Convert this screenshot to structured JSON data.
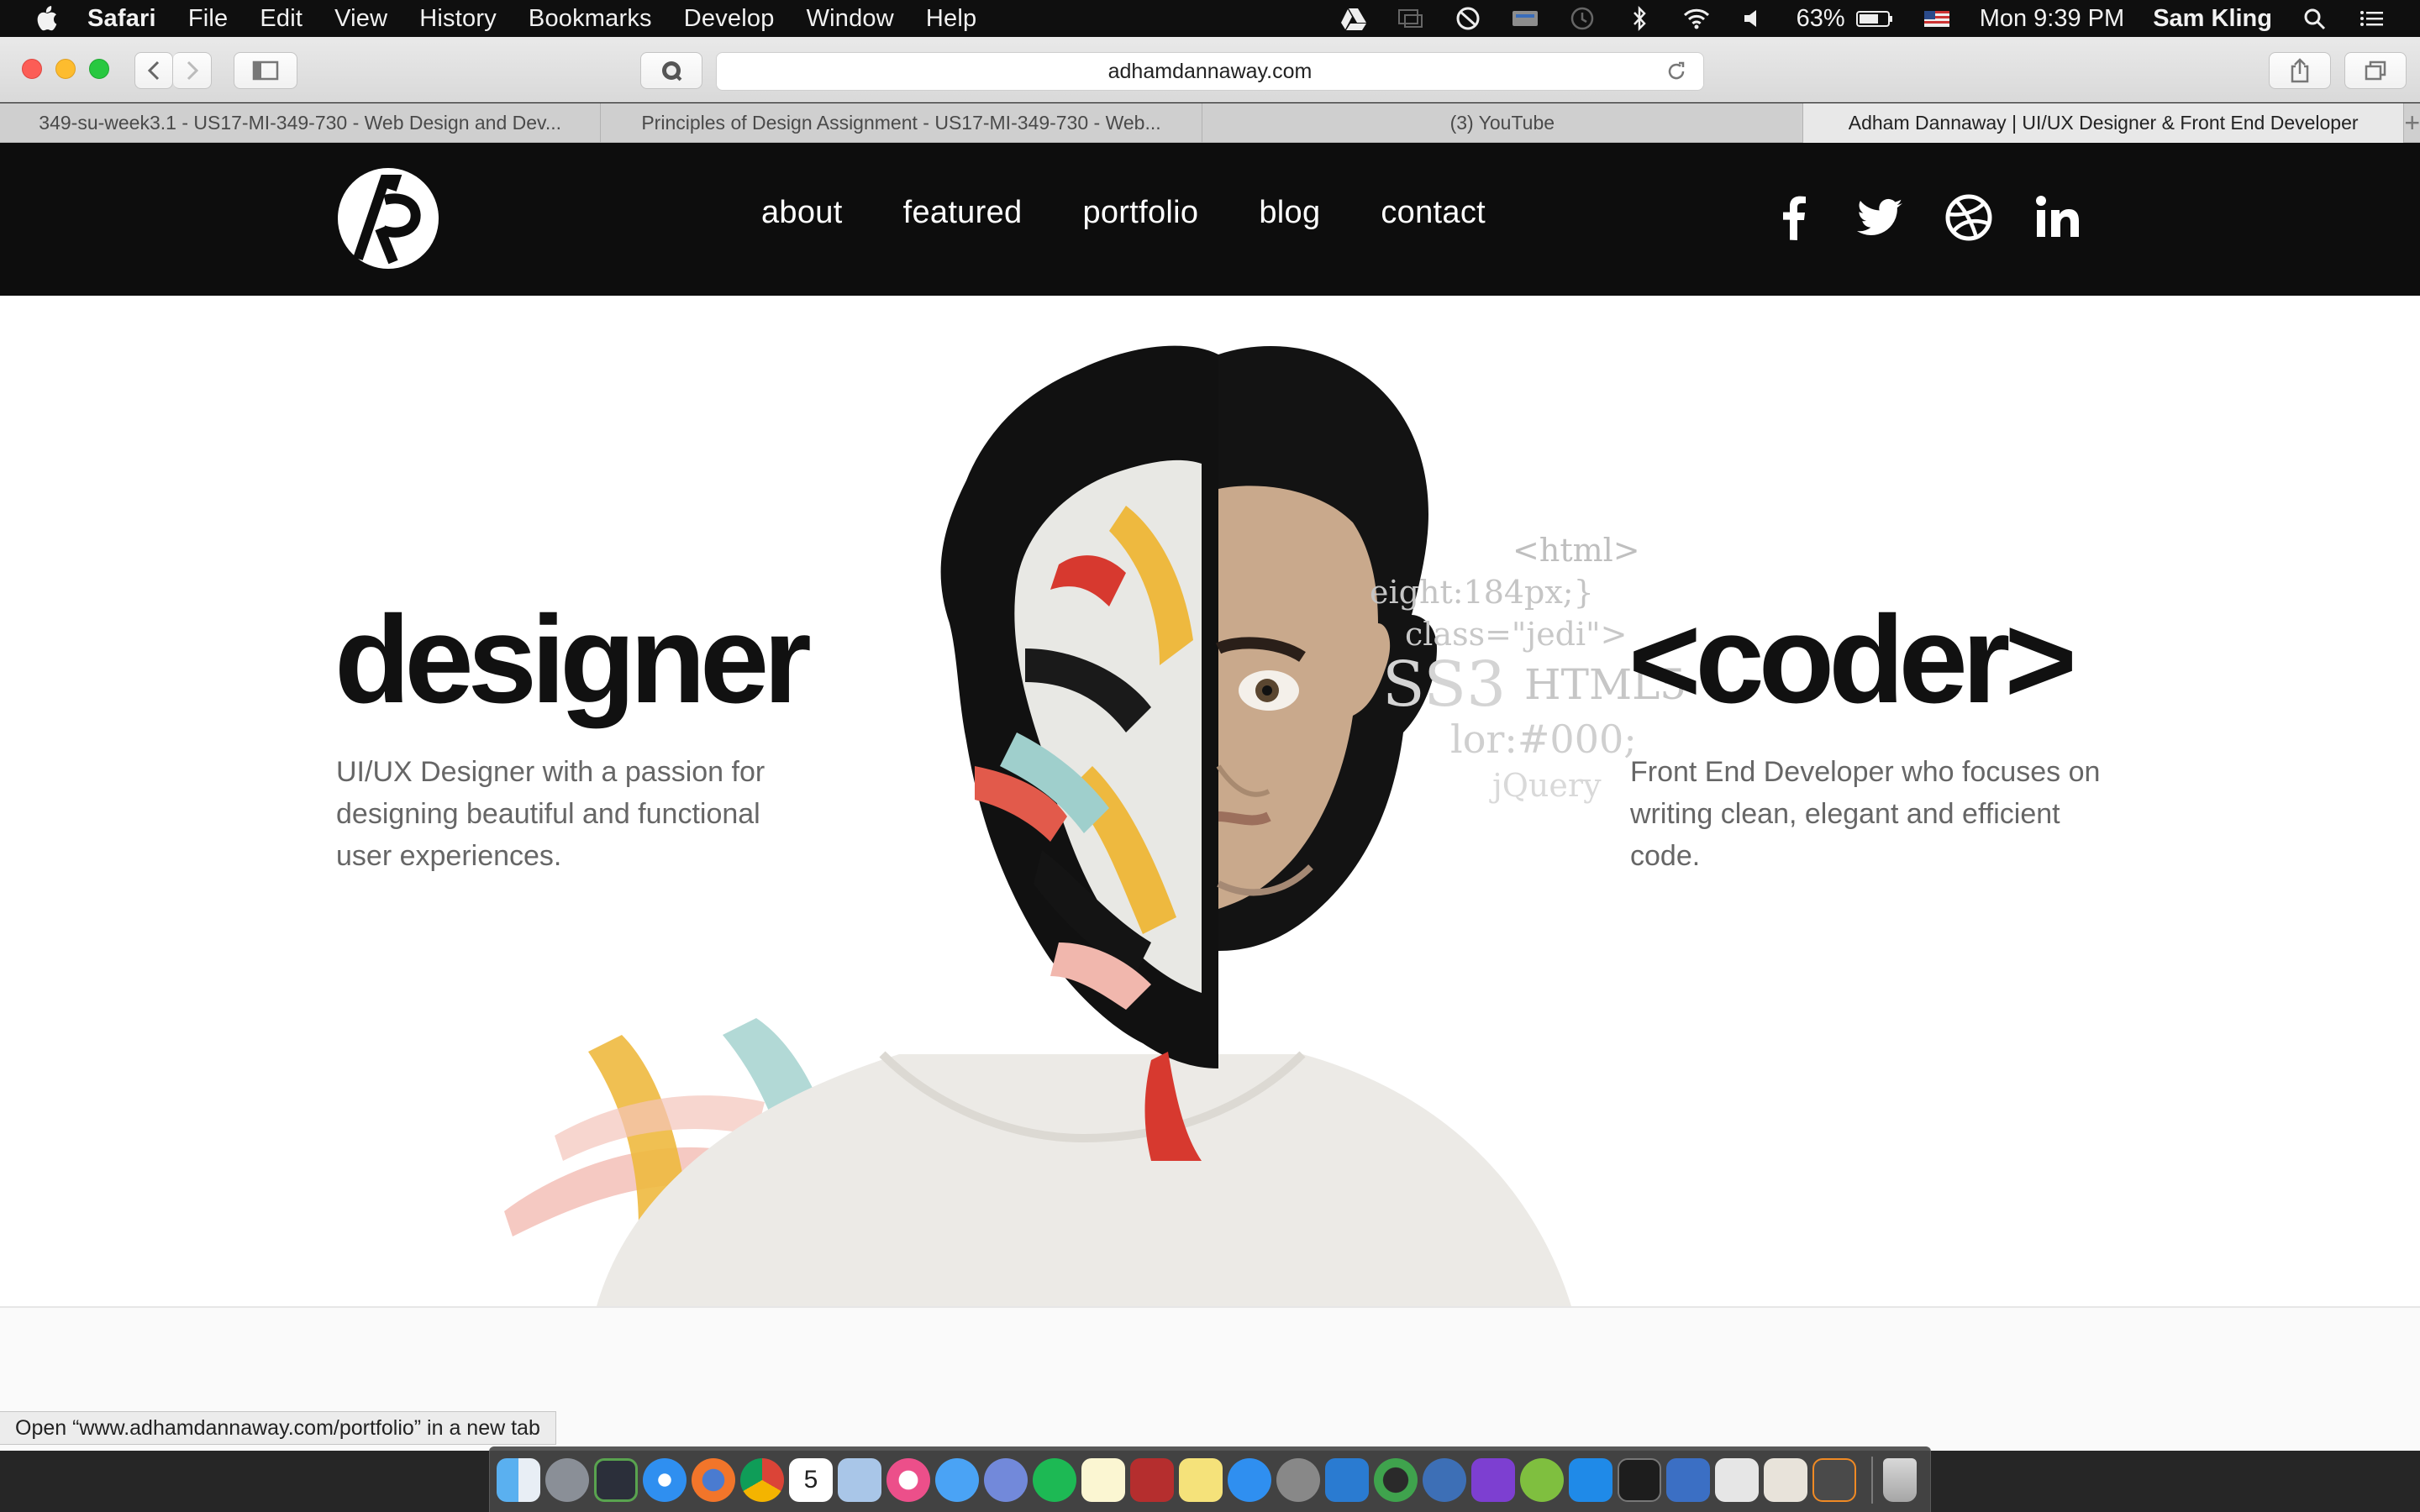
{
  "menubar": {
    "app": "Safari",
    "items": [
      "File",
      "Edit",
      "View",
      "History",
      "Bookmarks",
      "Develop",
      "Window",
      "Help"
    ],
    "battery": "63%",
    "clock": "Mon 9:39 PM",
    "user": "Sam Kling",
    "status_icons": [
      "google-drive-icon",
      "screen-mirror-icon",
      "do-not-disturb-icon",
      "keyboard-icon",
      "time-machine-icon",
      "bluetooth-icon",
      "wifi-icon",
      "volume-icon",
      "battery-icon",
      "us-flag-icon",
      "spotlight-search-icon",
      "notification-center-icon"
    ]
  },
  "toolbar": {
    "url": "adhamdannaway.com"
  },
  "tabs": [
    {
      "label": "349-su-week3.1 - US17-MI-349-730 - Web Design and Dev..."
    },
    {
      "label": "Principles of Design Assignment - US17-MI-349-730 - Web..."
    },
    {
      "label": "(3) YouTube"
    },
    {
      "label": "Adham Dannaway | UI/UX Designer & Front End Developer"
    }
  ],
  "site": {
    "nav": [
      "about",
      "featured",
      "portfolio",
      "blog",
      "contact"
    ],
    "social": [
      "facebook-icon",
      "twitter-icon",
      "dribbble-icon",
      "linkedin-icon"
    ],
    "designer": {
      "heading": "designer",
      "desc": "UI/UX Designer with a passion for designing beautiful and functional user experiences."
    },
    "coder": {
      "heading": "<coder>",
      "desc": "Front End Developer who focuses on writing clean, elegant and efficient code."
    },
    "code_snippets": [
      "<html>",
      "eight:184px;}",
      "class=\"jedi\">",
      "SS3",
      "HTML5",
      "lor:#000;",
      "jQuery"
    ]
  },
  "status_bar": {
    "text": "Open “www.adhamdannaway.com/portfolio” in a new tab"
  },
  "dock": {
    "apps": [
      "finder-icon",
      "launchpad-icon",
      "mission-control-icon",
      "safari-icon",
      "firefox-icon",
      "chrome-icon",
      "calendar-icon",
      "preview-icon",
      "itunes-icon",
      "messages-icon",
      "discord-icon",
      "spotify-icon",
      "notes-icon",
      "photo-booth-icon",
      "stickies-icon",
      "app-store-icon",
      "system-preferences-icon",
      "visual-studio-code-icon",
      "eclipse-icon",
      "r-icon",
      "phpstorm-icon",
      "android-studio-icon",
      "xcode-icon",
      "terminal-icon",
      "remote-desktop-icon",
      "pages-icon",
      "slack-icon",
      "sublime-icon",
      "trash-icon"
    ],
    "calendar_day": "5"
  }
}
